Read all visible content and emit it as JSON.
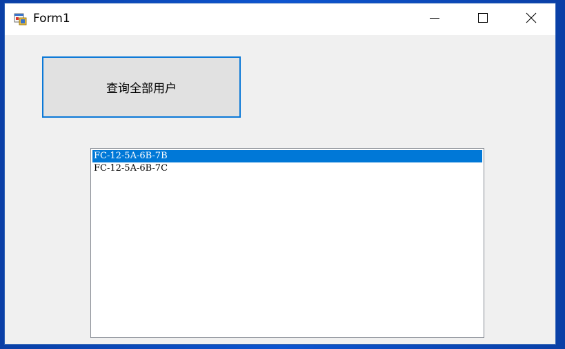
{
  "window": {
    "title": "Form1"
  },
  "controls": {
    "query_button_label": "查询全部用户"
  },
  "listbox": {
    "items": [
      {
        "label": "FC-12-5A-6B-7B",
        "selected": true
      },
      {
        "label": "FC-12-5A-6B-7C",
        "selected": false
      }
    ]
  },
  "colors": {
    "selection": "#0078d7",
    "button_border": "#0a78d7"
  }
}
